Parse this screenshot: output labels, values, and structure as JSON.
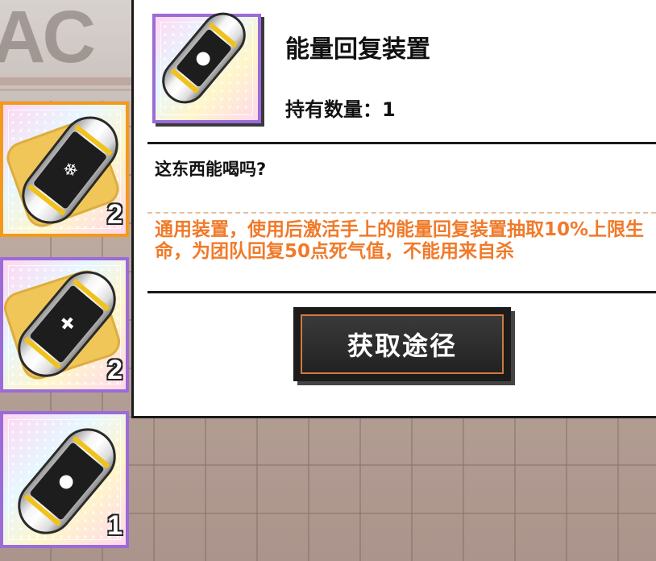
{
  "background": {
    "letters": "AC"
  },
  "item_list": [
    {
      "count": "2",
      "glyph": "❄",
      "selected": true
    },
    {
      "count": "2",
      "glyph": "✚",
      "selected": false
    },
    {
      "count": "1",
      "glyph": "●",
      "selected": false
    }
  ],
  "detail": {
    "name": "能量回复装置",
    "owned_label": "持有数量：",
    "owned_value": "1",
    "flavor": "这东西能喝吗?",
    "description": "通用装置，使用后激活手上的能量回复装置抽取10%上限生命，为团队回复50点死气值，不能用来自杀",
    "icon_glyph": "●"
  },
  "acquire_button": {
    "label": "获取途径"
  },
  "colors": {
    "description_text": "#f07a2a",
    "selected_border": "#f39a1c",
    "normal_border": "#9b6bd8",
    "button_ring": "#d2793d"
  }
}
